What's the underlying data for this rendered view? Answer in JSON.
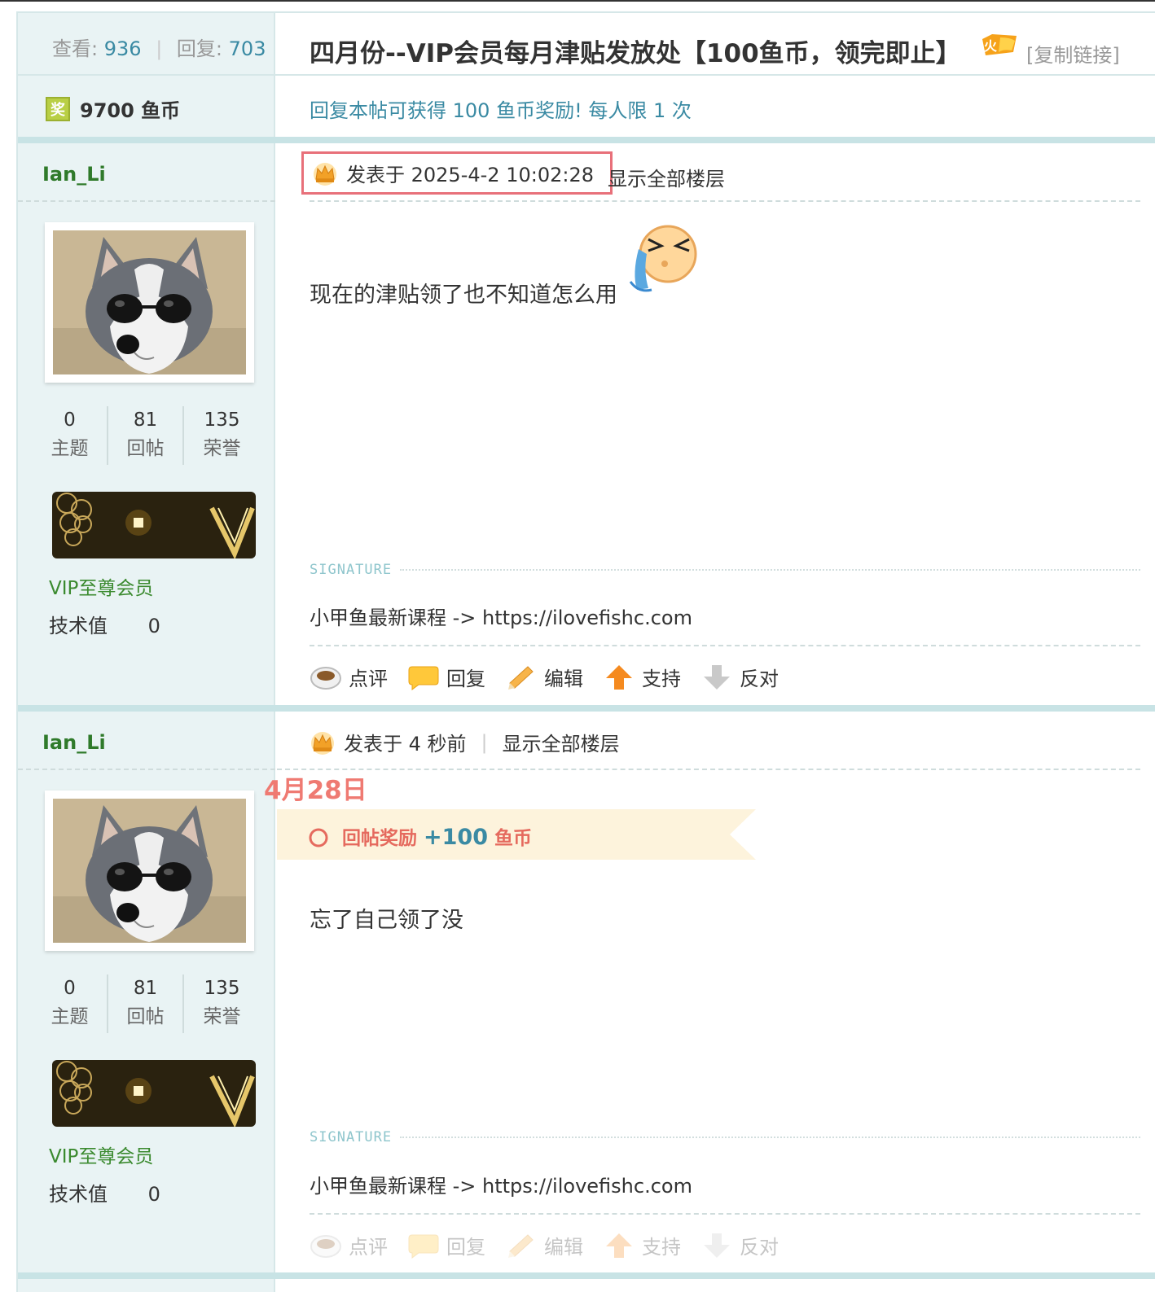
{
  "thread": {
    "views_label": "查看:",
    "views": "936",
    "replies_label": "回复:",
    "replies": "703",
    "title": "四月份--VIP会员每月津贴发放处【100鱼币，领完即止】",
    "hot_badge": "火",
    "copy_link": "[复制链接]",
    "reward_amount": "9700 鱼币",
    "reward_icon_text": "奖",
    "reward_note": "回复本帖可获得 100 鱼币奖励! 每人限 1 次"
  },
  "posts": [
    {
      "username": "Ian_Li",
      "stats": [
        {
          "value": "0",
          "label": "主题"
        },
        {
          "value": "81",
          "label": "回帖"
        },
        {
          "value": "135",
          "label": "荣誉"
        }
      ],
      "group": "VIP至尊会员",
      "tech_label": "技术值",
      "tech_value": "0",
      "posted": "发表于 2025-4-2 10:02:28",
      "show_all": "显示全部楼层",
      "content": "现在的津贴领了也不知道怎么用",
      "signature_label": "SIGNATURE",
      "signature": "小甲鱼最新课程 -> https://ilovefishc.com",
      "actions": [
        "点评",
        "回复",
        "编辑",
        "支持",
        "反对"
      ]
    },
    {
      "username": "Ian_Li",
      "stats": [
        {
          "value": "0",
          "label": "主题"
        },
        {
          "value": "81",
          "label": "回帖"
        },
        {
          "value": "135",
          "label": "荣誉"
        }
      ],
      "group": "VIP至尊会员",
      "tech_label": "技术值",
      "tech_value": "0",
      "posted": "发表于 4 秒前",
      "show_all": "显示全部楼层",
      "annotation": "4月28日",
      "reward_label": "回帖奖励",
      "reward_amount": "+100",
      "reward_unit": "鱼币",
      "content": "忘了自己领了没",
      "signature_label": "SIGNATURE",
      "signature": "小甲鱼最新课程 -> https://ilovefishc.com",
      "actions": [
        "点评",
        "回复",
        "编辑",
        "支持",
        "反对"
      ]
    }
  ],
  "colors": {
    "sidebar_bg": "#e9f3f4",
    "link_teal": "#3a8aa3",
    "username_green": "#2f7a2a",
    "annotation_red": "#ef7a72",
    "highlight_box": "#e8707a"
  }
}
